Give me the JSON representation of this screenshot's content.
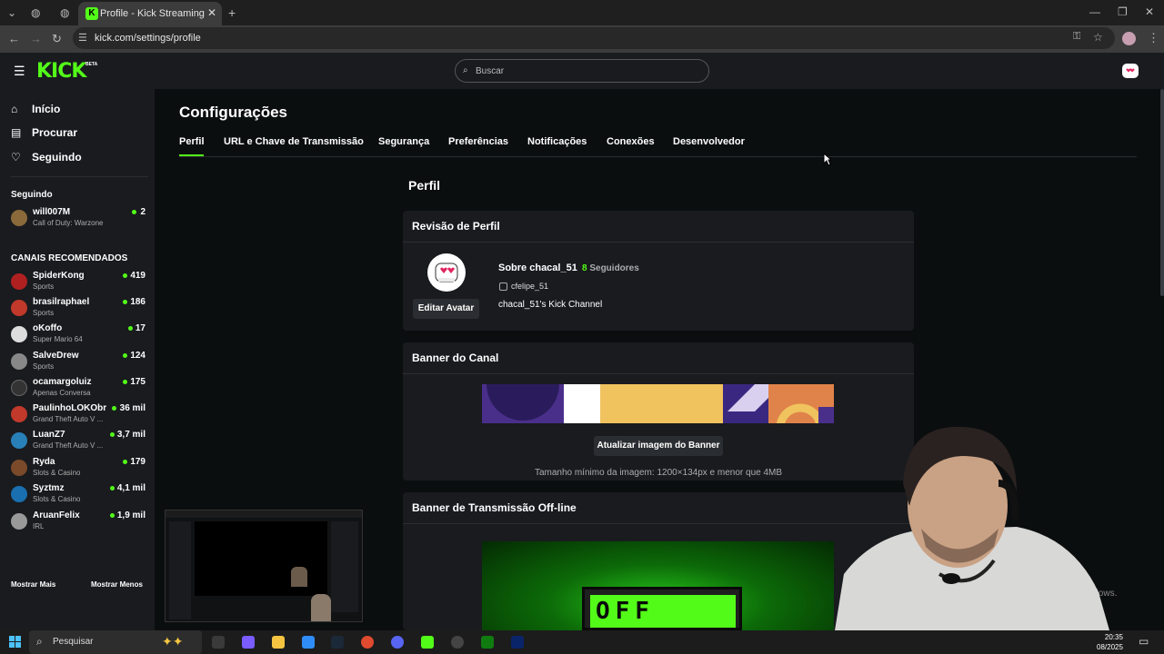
{
  "browser": {
    "tab_title": "Profile - Kick Streaming",
    "url": "kick.com/settings/profile"
  },
  "kick": {
    "logo": "KICK",
    "logo_badge": "BETA",
    "search_placeholder": "Buscar",
    "nav": [
      {
        "label": "Início",
        "icon": "home-icon"
      },
      {
        "label": "Procurar",
        "icon": "browse-icon"
      },
      {
        "label": "Seguindo",
        "icon": "heart-icon"
      }
    ],
    "following_title": "Seguindo",
    "following": [
      {
        "name": "will007M",
        "category": "Call of Duty: Warzone",
        "viewers": "2",
        "color": "#8a6a3a"
      }
    ],
    "recommended_title": "CANAIS RECOMENDADOS",
    "recommended": [
      {
        "name": "SpiderKong",
        "category": "Sports",
        "viewers": "419",
        "color": "#b02020"
      },
      {
        "name": "brasilraphael",
        "category": "Sports",
        "viewers": "186",
        "color": "#c0392b"
      },
      {
        "name": "oKoffo",
        "category": "Super Mario 64",
        "viewers": "17",
        "color": "#ddd"
      },
      {
        "name": "SalveDrew",
        "category": "Sports",
        "viewers": "124",
        "color": "#888"
      },
      {
        "name": "ocamargoluiz",
        "category": "Apenas Conversa",
        "viewers": "175",
        "color": "#333"
      },
      {
        "name": "PaulinhoLOKObr",
        "category": "Grand Theft Auto V ...",
        "viewers": "36 mil",
        "color": "#c0392b"
      },
      {
        "name": "LuanZ7",
        "category": "Grand Theft Auto V ...",
        "viewers": "3,7 mil",
        "color": "#2980b9"
      },
      {
        "name": "Ryda",
        "category": "Slots & Casino",
        "viewers": "179",
        "color": "#7a4a2a"
      },
      {
        "name": "Syztmz",
        "category": "Slots & Casino",
        "viewers": "4,1 mil",
        "color": "#1a6fb0"
      },
      {
        "name": "AruanFelix",
        "category": "IRL",
        "viewers": "1,9 mil",
        "color": "#999"
      }
    ],
    "show_more": "Mostrar Mais",
    "show_less": "Mostrar Menos",
    "settings_title": "Configurações",
    "tabs": [
      "Perfil",
      "URL e Chave de Transmissão",
      "Segurança",
      "Preferências",
      "Notificações",
      "Conexões",
      "Desenvolvedor"
    ],
    "section_title": "Perfil",
    "profile_review": {
      "title": "Revisão de Perfil",
      "edit_avatar": "Editar Avatar",
      "about": "Sobre chacal_51",
      "followers_count": "8",
      "followers_label": "Seguidores",
      "username": "cfelipe_51",
      "bio": "chacal_51's Kick Channel"
    },
    "channel_banner": {
      "title": "Banner do Canal",
      "update_button": "Atualizar imagem do Banner",
      "hint": "Tamanho mínimo da imagem: 1200×134px e menor que 4MB"
    },
    "offline_banner": {
      "title": "Banner de Transmissão Off-line",
      "sign_text": "OFF"
    },
    "accent": "#53fc18"
  },
  "overlay": {
    "windows_watermark": "Windows."
  },
  "taskbar": {
    "search_placeholder": "Pesquisar",
    "time": "20:35",
    "date": "08/2025"
  }
}
